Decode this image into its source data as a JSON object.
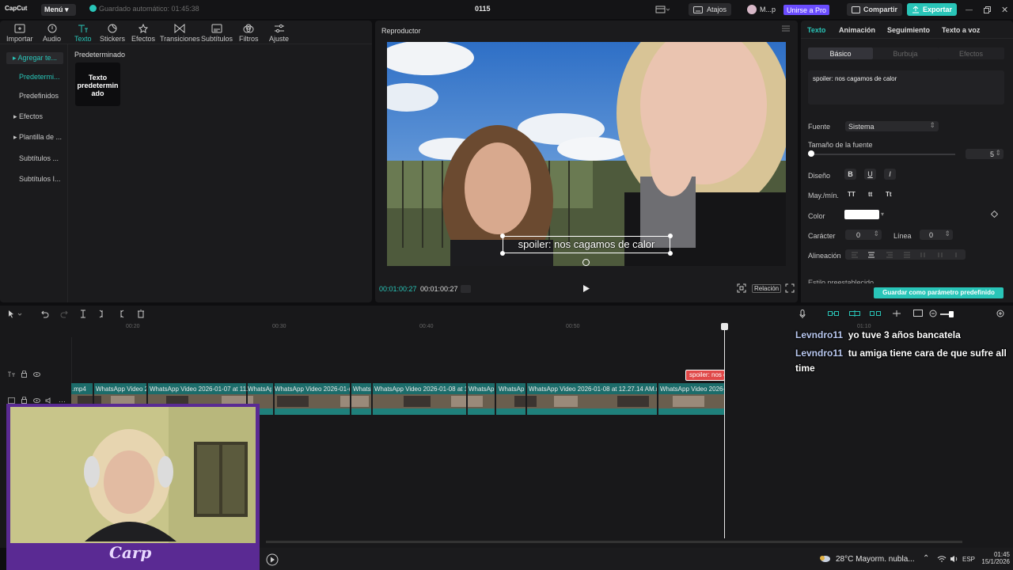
{
  "app": {
    "logo": "CapCut",
    "menu_label": "Menú",
    "autosave": "Guardado automático: 01:45:38",
    "project_title": "0115"
  },
  "topbar": {
    "shortcuts": "Atajos",
    "user": "M...p",
    "join_pro": "Unirse a Pro",
    "share": "Compartir",
    "export": "Exportar"
  },
  "toolbar": [
    {
      "label": "Importar",
      "icon": "import-icon"
    },
    {
      "label": "Audio",
      "icon": "audio-icon"
    },
    {
      "label": "Texto",
      "icon": "text-icon"
    },
    {
      "label": "Stickers",
      "icon": "stickers-icon"
    },
    {
      "label": "Efectos",
      "icon": "effects-icon"
    },
    {
      "label": "Transiciones",
      "icon": "transitions-icon"
    },
    {
      "label": "Subtítulos",
      "icon": "subtitles-icon"
    },
    {
      "label": "Filtros",
      "icon": "filters-icon"
    },
    {
      "label": "Ajuste",
      "icon": "adjust-icon"
    }
  ],
  "sidebar": [
    {
      "label": "▸ Agregar te..."
    },
    {
      "label": "Predetermi..."
    },
    {
      "label": "Predefinidos"
    },
    {
      "label": "▸ Efectos"
    },
    {
      "label": "▸ Plantilla de ..."
    },
    {
      "label": "Subtítulos ..."
    },
    {
      "label": "Subtítulos I..."
    }
  ],
  "library": {
    "section_title": "Predeterminado",
    "tile_text": "Texto predetermin ado"
  },
  "player": {
    "title": "Reproductor",
    "caption": "spoiler: nos cagamos de calor",
    "current_time": "00:01:00:27",
    "total_time": "00:01:00:27",
    "ratio_label": "Relación"
  },
  "properties": {
    "tabs": [
      "Texto",
      "Animación",
      "Seguimiento",
      "Texto a voz"
    ],
    "subtabs": [
      "Básico",
      "Burbuja",
      "Efectos"
    ],
    "text_value": "spoiler: nos cagamos de calor",
    "font_label": "Fuente",
    "font_value": "Sistema",
    "size_label": "Tamaño de la fuente",
    "size_value": "5",
    "design_label": "Diseño",
    "design_buttons": [
      "B",
      "U",
      "I"
    ],
    "case_label": "May./mín.",
    "case_buttons": [
      "TT",
      "tt",
      "Tt"
    ],
    "color_label": "Color",
    "color_value": "#ffffff",
    "char_label": "Carácter",
    "char_value": "0",
    "line_label": "Línea",
    "line_value": "0",
    "align_label": "Alineación",
    "preset_label": "Estilo preestablecido",
    "save_preset": "Guardar como parámetro predefinido"
  },
  "timeline": {
    "ruler": [
      "00:20",
      "00:30",
      "00:40",
      "00:50",
      "01:10"
    ],
    "text_clip": "spoiler: nos c",
    "video_clips": [
      ".mp4",
      "WhatsApp Video 2",
      "WhatsApp Video 2026-01-07 at 11.",
      "WhatsAp",
      "WhatsApp Video 2026-01-(",
      "Whats",
      "WhatsApp Video 2026-01-08 at 1",
      "WhatsAp",
      "WhatsAp",
      "WhatsApp Video 2026-01-08 at 12.27.14 AM.m",
      "WhatsApp Video 2026-("
    ]
  },
  "chat": [
    {
      "user": "Levndro11",
      "message": "yo tuve 3 años bancatela"
    },
    {
      "user": "Levndro11",
      "message": "tu amiga tiene cara de que sufre all time"
    }
  ],
  "overlay": {
    "logo_text": "Carp"
  },
  "taskbar": {
    "weather": "28°C  Mayorm. nubla...",
    "lang": "ESP",
    "time": "01:45",
    "date": "15/1/2026"
  },
  "colors": {
    "accent": "#29c5b8",
    "pro": "#6a4cff",
    "stream_frame": "#5a2a93",
    "text_clip": "#e04848"
  }
}
